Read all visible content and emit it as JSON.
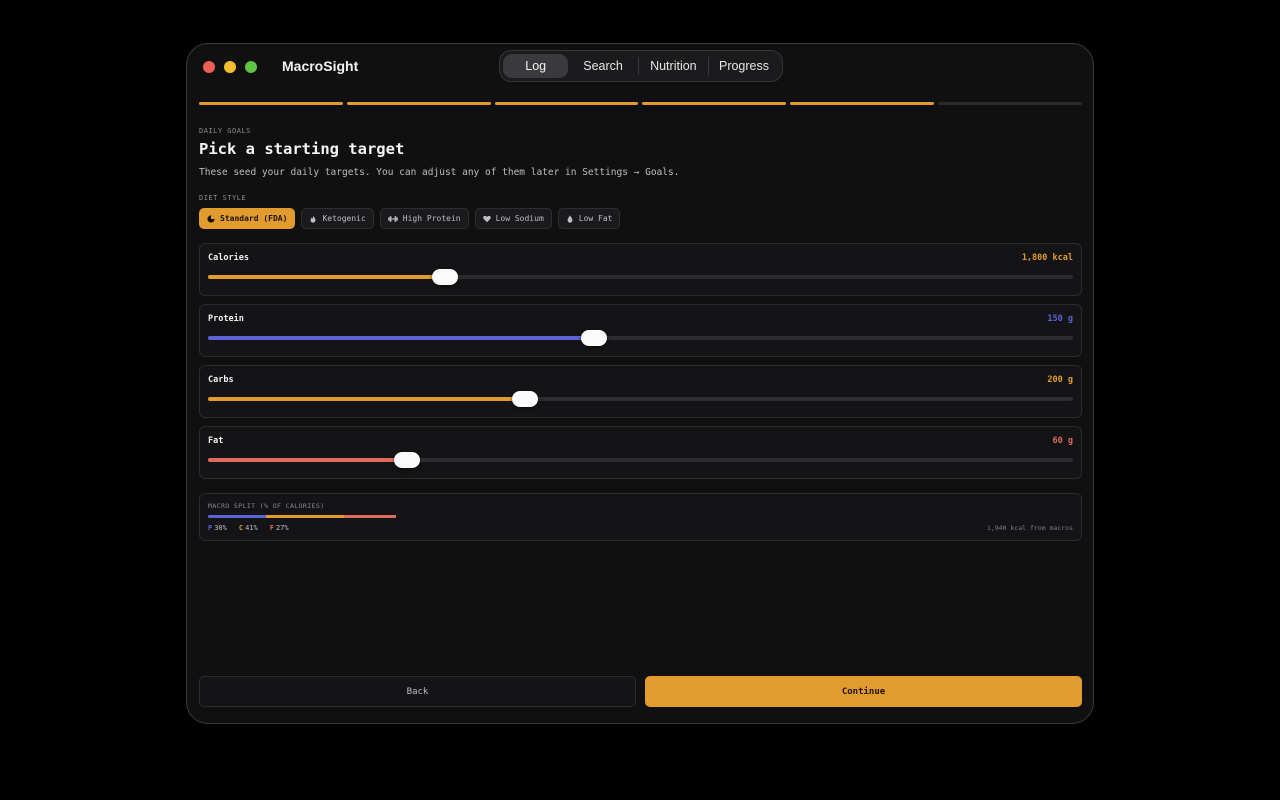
{
  "window": {
    "app_title": "MacroSight",
    "tabs": [
      {
        "label": "Log",
        "active": true
      },
      {
        "label": "Search",
        "active": false
      },
      {
        "label": "Nutrition",
        "active": false
      },
      {
        "label": "Progress",
        "active": false
      }
    ]
  },
  "wizard": {
    "steps_total": 6,
    "steps_completed": 5,
    "accent_color": "#e19b2e"
  },
  "header": {
    "eyebrow": "DAILY GOALS",
    "title": "Pick a starting target",
    "subtitle": "These seed your daily targets. You can adjust any of them later in Settings → Goals."
  },
  "diet_style": {
    "label": "DIET STYLE",
    "options": [
      {
        "label": "Standard (FDA)",
        "icon": "pie-icon",
        "active": true
      },
      {
        "label": "Ketogenic",
        "icon": "flame-icon",
        "active": false
      },
      {
        "label": "High Protein",
        "icon": "dumbbell-icon",
        "active": false
      },
      {
        "label": "Low Sodium",
        "icon": "heart-icon",
        "active": false
      },
      {
        "label": "Low Fat",
        "icon": "drop-icon",
        "active": false
      }
    ]
  },
  "targets": [
    {
      "label": "Calories",
      "value": "1,800 kcal",
      "fraction": 0.274,
      "color": "#e19b2e"
    },
    {
      "label": "Protein",
      "value": "150 g",
      "fraction": 0.446,
      "color": "#5b63d6"
    },
    {
      "label": "Carbs",
      "value": "200 g",
      "fraction": 0.366,
      "color": "#e19b2e"
    },
    {
      "label": "Fat",
      "value": "60 g",
      "fraction": 0.23,
      "color": "#e06a5e"
    }
  ],
  "macro_split": {
    "label": "MACRO SPLIT (% OF CALORIES)",
    "items": [
      {
        "key": "P",
        "value": "30%",
        "percent": 30,
        "color": "#5b63d6"
      },
      {
        "key": "C",
        "value": "41%",
        "percent": 41,
        "color": "#e19b2e"
      },
      {
        "key": "F",
        "value": "27%",
        "percent": 27,
        "color": "#e06a5e"
      }
    ],
    "total": "1,940 kcal from macros"
  },
  "footer": {
    "back_label": "Back",
    "continue_label": "Continue"
  }
}
